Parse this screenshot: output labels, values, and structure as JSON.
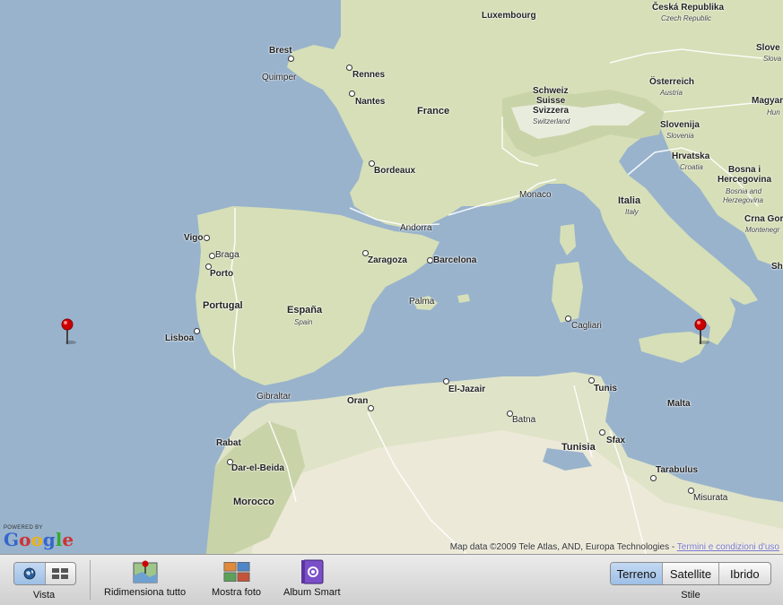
{
  "map": {
    "labels": {
      "luxembourg": "Luxembourg",
      "ceska": "Česká Republika",
      "ceska_sub": "Czech Republic",
      "brest": "Brest",
      "quimper": "Quimper",
      "rennes": "Rennes",
      "nantes": "Nantes",
      "france": "France",
      "schweiz1": "Schweiz",
      "schweiz2": "Suisse",
      "schweiz3": "Svizzera",
      "schweiz_sub": "Switzerland",
      "osterreich": "Österreich",
      "osterreich_sub": "Austria",
      "slovenija": "Slovenija",
      "slovenija_sub": "Slovenia",
      "hrvatska": "Hrvatska",
      "hrvatska_sub": "Croatia",
      "bosna1": "Bosna i",
      "bosna2": "Hercegovina",
      "bosna_sub1": "Bosnia and",
      "bosna_sub2": "Herzegovina",
      "crna": "Crna Gor",
      "crna_sub": "Montenegr",
      "slove": "Slove",
      "slova": "Slova",
      "magyar": "Magyar",
      "hun": "Hun",
      "sh": "Sh",
      "bordeaux": "Bordeaux",
      "monaco": "Monaco",
      "italia": "Italia",
      "italia_sub": "Italy",
      "andorra": "Andorra",
      "vigo": "Vigo",
      "braga": "Braga",
      "porto": "Porto",
      "portugal": "Portugal",
      "lisboa": "Lisboa",
      "zaragoza": "Zaragoza",
      "barcelona": "Barcelona",
      "espana": "España",
      "espana_sub": "Spain",
      "palma": "Palma",
      "cagliari": "Cagliari",
      "gibraltar": "Gibraltar",
      "oran": "Oran",
      "eljazair": "El-Jazair",
      "tunis": "Tunis",
      "malta": "Malta",
      "batna": "Batna",
      "tunisia": "Tunisia",
      "sfax": "Sfax",
      "rabat": "Rabat",
      "darelbeida": "Dar-el-Beida",
      "morocco": "Morocco",
      "tarabulus": "Tarabulus",
      "misurata": "Misurata"
    },
    "powered_by": "POWERED BY",
    "google_logo": "Google",
    "copyright": "Map data ©2009 Tele Atlas, AND, Europa Technologies - ",
    "terms_link": "Termini e condizioni d'uso",
    "pin_color": "#cc0000"
  },
  "toolbar": {
    "view_label": "Vista",
    "view_globe_icon": "globe-icon",
    "view_grid_icon": "grid-icon",
    "resize_all_label": "Ridimensiona tutto",
    "show_photos_label": "Mostra foto",
    "smart_album_label": "Album Smart",
    "style_label": "Stile",
    "style_options": [
      "Terreno",
      "Satellite",
      "Ibrido"
    ],
    "style_selected": "Terreno"
  },
  "colors": {
    "sea": "#99b3cc",
    "land": "#d6dfb7",
    "accent": "#9dbfe6"
  }
}
